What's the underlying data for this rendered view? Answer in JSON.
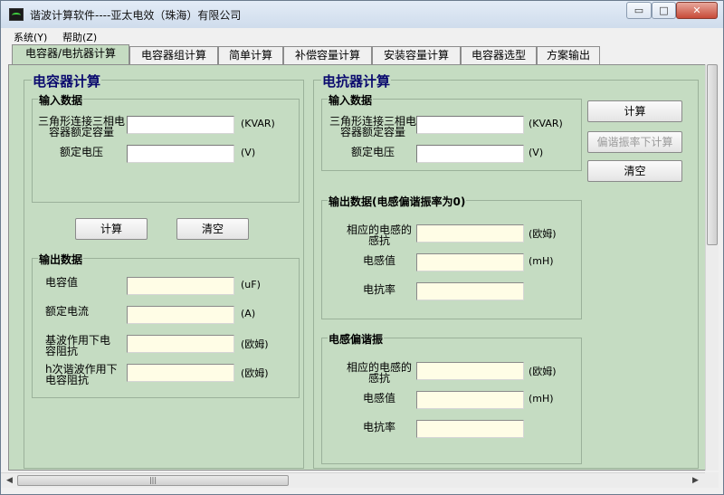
{
  "window": {
    "title": "谐波计算软件----亚太电效（珠海）有限公司",
    "min_glyph": "▭",
    "max_glyph": "□",
    "close_glyph": "✕"
  },
  "menu": {
    "items": [
      "系统(Y)",
      "帮助(Z)"
    ]
  },
  "tabs": [
    {
      "label": "电容器/电抗器计算",
      "active": true
    },
    {
      "label": "电容器组计算"
    },
    {
      "label": "简单计算"
    },
    {
      "label": "补偿容量计算"
    },
    {
      "label": "安装容量计算"
    },
    {
      "label": "电容器选型"
    },
    {
      "label": "方案输出"
    }
  ],
  "capacitor": {
    "title": "电容器计算",
    "input_title": "输入数据",
    "rated_capacity_label": "三角形连接三相电容器额定容量",
    "rated_capacity_unit": "(KVAR)",
    "rated_voltage_label": "额定电压",
    "rated_voltage_unit": "(V)",
    "calc_button": "计算",
    "clear_button": "清空",
    "output_title": "输出数据",
    "capacitance_label": "电容值",
    "capacitance_unit": "(uF)",
    "rated_current_label": "额定电流",
    "rated_current_unit": "(A)",
    "fundamental_impedance_label": "基波作用下电容阻抗",
    "fundamental_impedance_unit": "(欧姆)",
    "harmonic_impedance_label": "h次谐波作用下电容阻抗",
    "harmonic_impedance_unit": "(欧姆)"
  },
  "reactor": {
    "title": "电抗器计算",
    "input_title": "输入数据",
    "rated_capacity_label": "三角形连接三相电容器额定容量",
    "rated_capacity_unit": "(KVAR)",
    "rated_voltage_label": "额定电压",
    "rated_voltage_unit": "(V)",
    "calc_button": "计算",
    "detuned_calc_button": "偏谐振率下计算",
    "clear_button": "清空",
    "output_title": "输出数据(电感偏谐振率为0)",
    "reactance_label": "相应的电感的感抗",
    "reactance_unit": "(欧姆)",
    "inductance_label": "电感值",
    "inductance_unit": "(mH)",
    "reactance_rate_label": "电抗率",
    "detuned_title": "电感偏谐振",
    "detuned_reactance_label": "相应的电感的感抗",
    "detuned_reactance_unit": "(欧姆)",
    "detuned_inductance_label": "电感值",
    "detuned_inductance_unit": "(mH)",
    "detuned_rate_label": "电抗率"
  },
  "scrollbar": {
    "grip_glyph": "|||",
    "left_glyph": "◀",
    "right_glyph": "▶"
  }
}
